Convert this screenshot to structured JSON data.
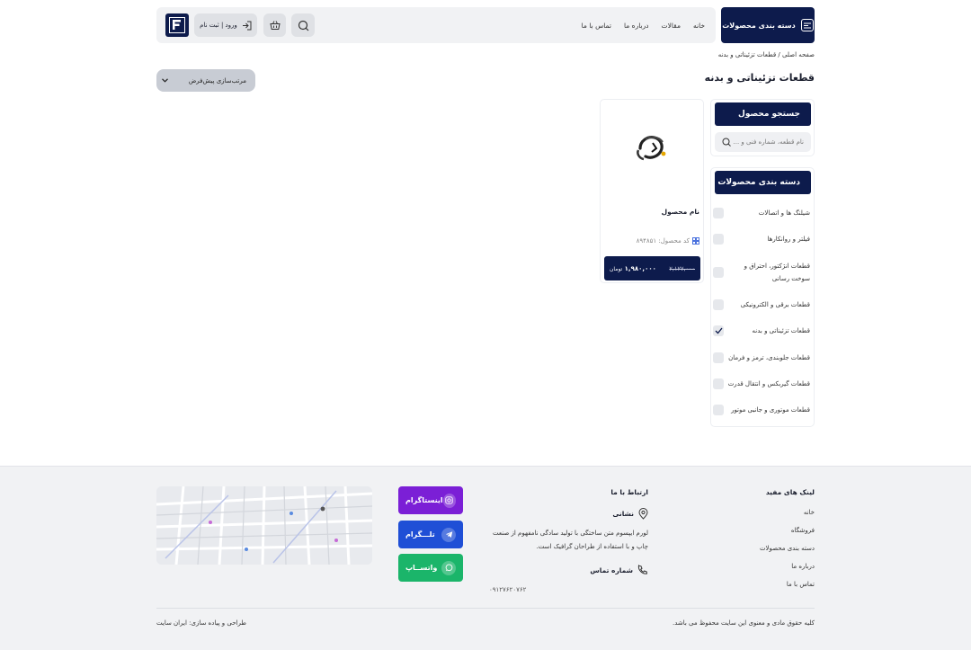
{
  "header": {
    "categories_button": "دسته بندی محصولات",
    "nav": [
      "خانه",
      "مقالات",
      "درباره ما",
      "تماس با ما"
    ],
    "login_label": "ورود | ثبت نام"
  },
  "breadcrumb": "صفحه اصلی / قطعات تزئیناتی و بدنه",
  "page_title": "قطعات تزئیناتی و بدنه",
  "sort": {
    "selected": "مرتب‌سازی پیش‌فرض"
  },
  "sidebar": {
    "search_title": "جستجو محصول",
    "search_placeholder": "نام قطعه، شماره فنی و ...",
    "categories_title": "دسته بندی محصولات",
    "categories": [
      {
        "label": "شیلنگ ها و اتصالات",
        "checked": false
      },
      {
        "label": "فیلتر و روانکارها",
        "checked": false
      },
      {
        "label": "قطعات انژکتور، احتراق و سوخت رسانی",
        "checked": false
      },
      {
        "label": "قطعات برقی و الکترونیکی",
        "checked": false
      },
      {
        "label": "قطعات تزئیناتی و بدنه",
        "checked": true
      },
      {
        "label": "قطعات جلوبندی، ترمز و فرمان",
        "checked": false
      },
      {
        "label": "قطعات گیربکس و انتقال قدرت",
        "checked": false
      },
      {
        "label": "قطعات موتوری و جانبی موتور",
        "checked": false
      }
    ]
  },
  "product": {
    "name": "نام محصول",
    "code_label": "کد محصول: ۸۹۴۸۵۱",
    "old_price": "۲,۱۲۷,۰۰۰",
    "new_price": "۱,۹۸۰,۰۰۰",
    "currency": "تومان"
  },
  "footer": {
    "links_title": "لینک های مفید",
    "links": [
      "خانه",
      "فروشگاه",
      "دسته بندی محصولات",
      "درباره ما",
      "تماس با ما"
    ],
    "contact_title": "ارتباط با ما",
    "address_title": "نشانی",
    "address_text": "لورم ایپسوم متن ساختگی با تولید سادگی نامفهوم از صنعت چاپ و با استفاده از طراحان گرافیک است.",
    "phone_title": "شماره تماس",
    "phone": "۰۹۱۲۷۶۲۰۷۶۲",
    "social": [
      {
        "label": "اینستاگرام",
        "color": "#7b1fd6"
      },
      {
        "label": "تلـــگرام",
        "color": "#1f4fd6"
      },
      {
        "label": "واتســاپ",
        "color": "#1bb56a"
      }
    ],
    "copyright": "کلیه حقوق مادی و معنوی این سایت محفوظ می باشد.",
    "credit": "طراحی و پیاده سازی: ایران سایت"
  },
  "colors": {
    "primary": "#0d1b4c",
    "background": "#ffffff",
    "panel": "#f1f2f4"
  }
}
